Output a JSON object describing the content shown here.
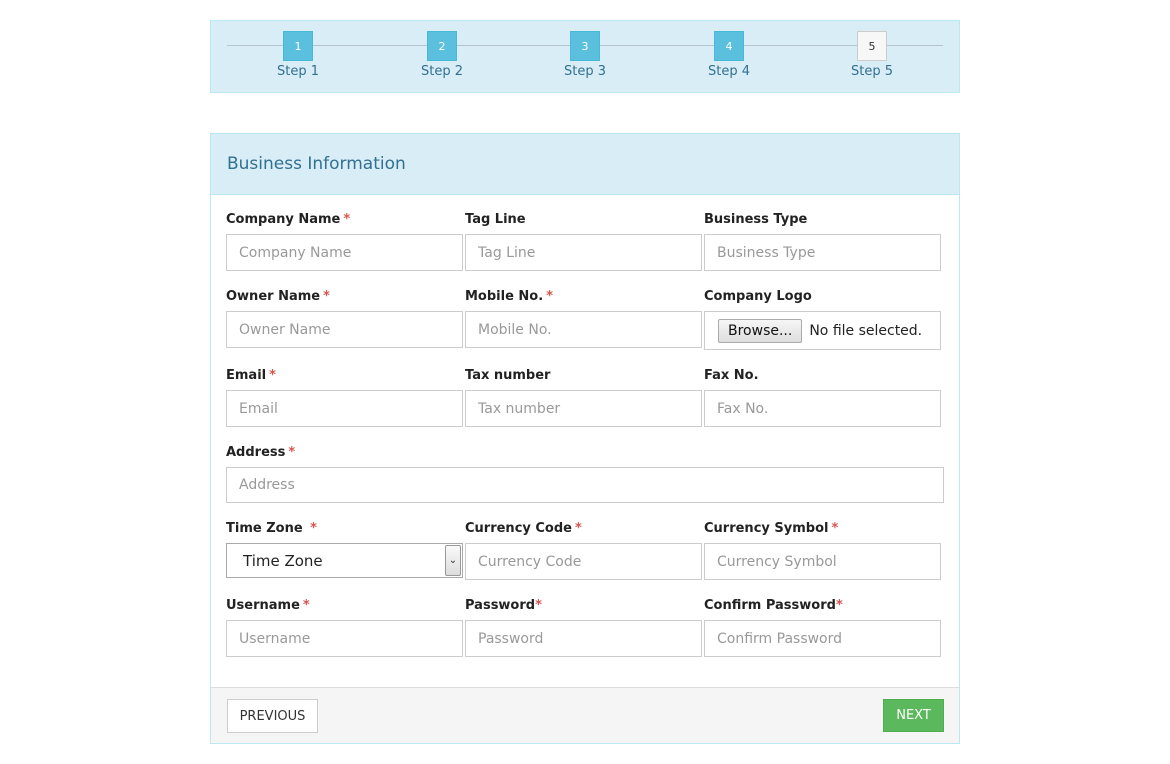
{
  "stepper": {
    "steps": [
      {
        "number": "1",
        "label": "Step 1",
        "state": "complete"
      },
      {
        "number": "2",
        "label": "Step 2",
        "state": "complete"
      },
      {
        "number": "3",
        "label": "Step 3",
        "state": "complete"
      },
      {
        "number": "4",
        "label": "Step 4",
        "state": "complete"
      },
      {
        "number": "5",
        "label": "Step 5",
        "state": "inactive"
      }
    ]
  },
  "form": {
    "title": "Business Information",
    "required_mark": "*",
    "company_name": {
      "label": "Company Name",
      "placeholder": "Company Name"
    },
    "tag_line": {
      "label": "Tag Line",
      "placeholder": "Tag Line"
    },
    "business_type": {
      "label": "Business Type",
      "placeholder": "Business Type"
    },
    "owner_name": {
      "label": "Owner Name",
      "placeholder": "Owner Name"
    },
    "mobile_no": {
      "label": "Mobile No.",
      "placeholder": "Mobile No."
    },
    "company_logo": {
      "label": "Company Logo",
      "button": "Browse...",
      "status": "No file selected."
    },
    "email": {
      "label": "Email",
      "placeholder": "Email"
    },
    "tax_number": {
      "label": "Tax number",
      "placeholder": "Tax number"
    },
    "fax_no": {
      "label": "Fax No.",
      "placeholder": "Fax No."
    },
    "address": {
      "label": "Address",
      "placeholder": "Address"
    },
    "time_zone": {
      "label": "Time Zone ",
      "selected": "Time Zone"
    },
    "currency_code": {
      "label": "Currency Code",
      "placeholder": "Currency Code"
    },
    "currency_symbol": {
      "label": "Currency Symbol",
      "placeholder": "Currency Symbol"
    },
    "username": {
      "label": "Username",
      "placeholder": "Username"
    },
    "password": {
      "label": "Password",
      "placeholder": "Password"
    },
    "confirm_password": {
      "label": "Confirm Password",
      "placeholder": "Confirm Password"
    }
  },
  "footer": {
    "previous_label": "PREVIOUS",
    "next_label": "NEXT"
  },
  "colors": {
    "accent": "#5bc0de",
    "panel_heading": "#d9edf7",
    "title_text": "#31708f",
    "required": "#d9534f",
    "next_button": "#5cb85c"
  }
}
